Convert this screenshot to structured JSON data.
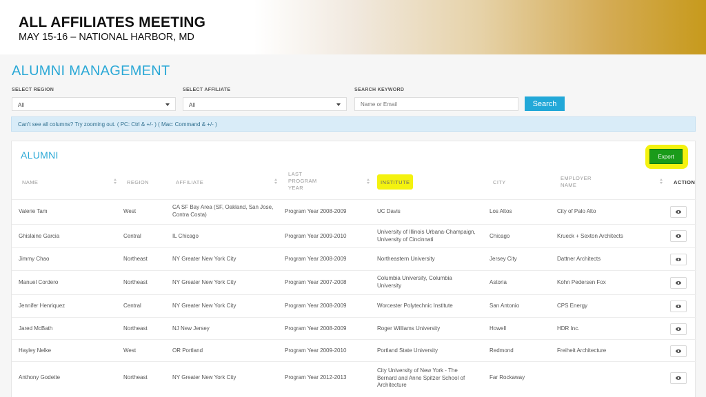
{
  "banner": {
    "title": "ALL AFFILIATES MEETING",
    "subtitle": "MAY 15-16 – NATIONAL HARBOR, MD"
  },
  "page": {
    "title": "ALUMNI MANAGEMENT"
  },
  "filters": {
    "region_label": "SELECT REGION",
    "region_value": "All",
    "affiliate_label": "SELECT AFFILIATE",
    "affiliate_value": "All",
    "keyword_label": "SEARCH KEYWORD",
    "keyword_placeholder": "Name or Email",
    "search_button": "Search"
  },
  "info": {
    "message": "Can't see all columns? Try zooming out. ( PC: Ctrl & +/- ) ( Mac: Command & +/- )"
  },
  "panel": {
    "title": "ALUMNI",
    "export_button": "Export"
  },
  "table": {
    "headers": {
      "name": "NAME",
      "region": "REGION",
      "affiliate": "AFFILIATE",
      "program_year": "LAST PROGRAM YEAR",
      "institute": "INSTITUTE",
      "city": "CITY",
      "employer": "EMPLOYER NAME",
      "action": "ACTION"
    },
    "rows": [
      {
        "name": "Valerie Tam",
        "region": "West",
        "affiliate": "CA SF Bay Area (SF, Oakland, San Jose, Contra Costa)",
        "program_year": "Program Year 2008-2009",
        "institute": "UC Davis",
        "city": "Los Altos",
        "employer": "City of Palo Alto"
      },
      {
        "name": "Ghislaine Garcia",
        "region": "Central",
        "affiliate": "IL Chicago",
        "program_year": "Program Year 2009-2010",
        "institute": "University of Illinois Urbana-Champaign, University of Cincinnati",
        "city": "Chicago",
        "employer": "Krueck + Sexton Architects"
      },
      {
        "name": "Jimmy Chao",
        "region": "Northeast",
        "affiliate": "NY Greater New York City",
        "program_year": "Program Year 2008-2009",
        "institute": "Northeastern University",
        "city": "Jersey City",
        "employer": "Dattner Architects"
      },
      {
        "name": "Manuel Cordero",
        "region": "Northeast",
        "affiliate": "NY Greater New York City",
        "program_year": "Program Year 2007-2008",
        "institute": "Columbia University, Columbia University",
        "city": "Astoria",
        "employer": "Kohn Pedersen Fox"
      },
      {
        "name": "Jennifer Henriquez",
        "region": "Central",
        "affiliate": "NY Greater New York City",
        "program_year": "Program Year 2008-2009",
        "institute": "Worcester Polytechnic Institute",
        "city": "San Antonio",
        "employer": "CPS Energy"
      },
      {
        "name": "Jared McBath",
        "region": "Northeast",
        "affiliate": "NJ New Jersey",
        "program_year": "Program Year 2008-2009",
        "institute": "Roger Williams University",
        "city": "Howell",
        "employer": "HDR Inc."
      },
      {
        "name": "Hayley Nelke",
        "region": "West",
        "affiliate": "OR Portland",
        "program_year": "Program Year 2009-2010",
        "institute": "Portland State University",
        "city": "Redmond",
        "employer": "Freiheit Architecture"
      },
      {
        "name": "Anthony Godette",
        "region": "Northeast",
        "affiliate": "NY Greater New York City",
        "program_year": "Program Year 2012-2013",
        "institute": "City University of New York - The Bernard and Anne Spitzer School of Architecture",
        "city": "Far Rockaway",
        "employer": ""
      }
    ]
  },
  "colors": {
    "accent": "#2aa8d6",
    "export": "#1a9b1a",
    "highlight": "#f4f20f",
    "banner_gold": "#c79a1c"
  }
}
